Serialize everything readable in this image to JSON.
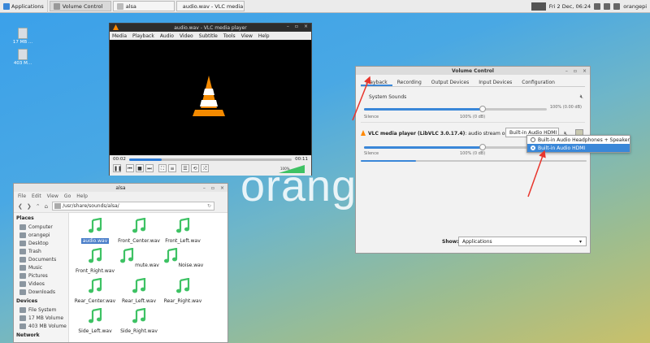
{
  "panel": {
    "applications": "Applications",
    "tasks": [
      "Volume Control",
      "alsa",
      "audio.wav - VLC media ...",
      "orangepi"
    ],
    "clock": "Fri 2 Dec, 06:24"
  },
  "desktop": {
    "brand": "orang",
    "icons": [
      "17 MB ...",
      "403 M..."
    ]
  },
  "vlc": {
    "title": "audio.wav - VLC media player",
    "menu": [
      "Media",
      "Playback",
      "Audio",
      "Video",
      "Subtitle",
      "Tools",
      "View",
      "Help"
    ],
    "time_elapsed": "00:02",
    "time_total": "00:11",
    "progress": 0.2,
    "volume_label": "100%"
  },
  "files": {
    "title": "alsa",
    "menu": [
      "File",
      "Edit",
      "View",
      "Go",
      "Help"
    ],
    "location": "/usr/share/sounds/alsa/",
    "places_header": "Places",
    "places": [
      "Computer",
      "orangepi",
      "Desktop",
      "Trash",
      "Documents",
      "Music",
      "Pictures",
      "Videos",
      "Downloads"
    ],
    "devices_header": "Devices",
    "devices": [
      "File System",
      "17 MB Volume",
      "403 MB Volume"
    ],
    "network_header": "Network",
    "items": [
      "audio.wav",
      "Front_Center.wav",
      "Front_Left.wav",
      "Front_Right.wav",
      "mute.wav",
      "Noise.wav",
      "Rear_Center.wav",
      "Rear_Left.wav",
      "Rear_Right.wav",
      "Side_Left.wav",
      "Side_Right.wav"
    ],
    "selected": "audio.wav"
  },
  "volume": {
    "title": "Volume Control",
    "tabs": [
      "Playback",
      "Recording",
      "Output Devices",
      "Input Devices",
      "Configuration"
    ],
    "active_tab": "Playback",
    "system_sounds": "System Sounds",
    "level_text": "100% (0.00 dB)",
    "silence": "Silence",
    "zero_db": "100% (0 dB)",
    "stream_label": "VLC media player (LibVLC 3.0.17.4)",
    "stream_suffix": ": audio stream on",
    "device_combo": "Built-in Audio HDMI",
    "show_label": "Show:",
    "show_value": "Applications",
    "popup_options": [
      "Built-in Audio Headphones + Speaker",
      "Built-in Audio HDMI"
    ],
    "popup_selected": 1
  },
  "colors": {
    "accent": "#3a87d8",
    "annotation": "#e8352c",
    "note_green": "#3ec264"
  }
}
